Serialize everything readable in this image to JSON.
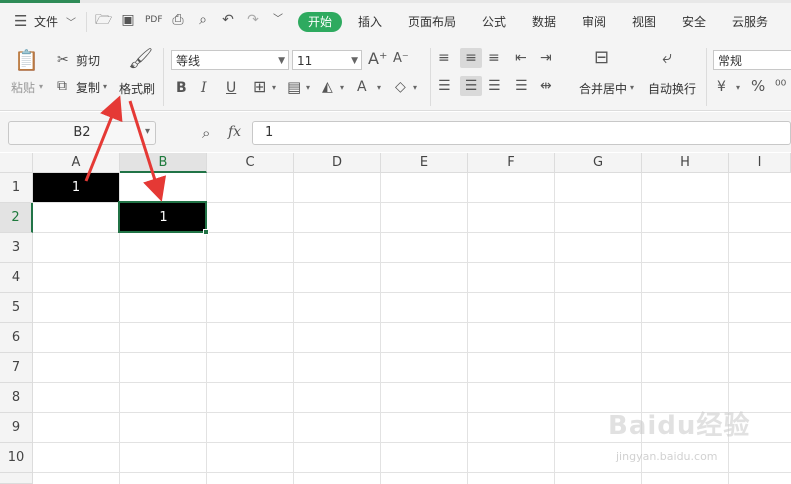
{
  "menubar": {
    "file_label": "文件",
    "tabs": [
      "开始",
      "插入",
      "页面布局",
      "公式",
      "数据",
      "审阅",
      "视图",
      "安全",
      "云服务"
    ],
    "active_tab": "开始"
  },
  "ribbon": {
    "paste_label": "粘贴",
    "cut_label": "剪切",
    "copy_label": "复制",
    "format_painter_label": "格式刷",
    "font_name": "等线",
    "font_size": "11",
    "merge_center_label": "合并居中",
    "wrap_text_label": "自动换行",
    "number_format": "常规",
    "percent_symbol": "%"
  },
  "formula_bar": {
    "name_box": "B2",
    "fx_label": "fx",
    "value": "1"
  },
  "sheet": {
    "columns": [
      "A",
      "B",
      "C",
      "D",
      "E",
      "F",
      "G",
      "H",
      "I"
    ],
    "rows": [
      "1",
      "2",
      "3",
      "4",
      "5",
      "6",
      "7",
      "8",
      "9",
      "10"
    ],
    "cells": {
      "A1": "1",
      "B2": "1"
    },
    "selected_cell": "B2"
  },
  "annotation": {
    "arrow_color": "#e53935"
  },
  "watermark": {
    "brand": "Baidu经验",
    "url": "jingyan.baidu.com"
  },
  "colors": {
    "accent_green": "#2eaa5f",
    "selection_green": "#217346",
    "cell_fill": "#000000",
    "cell_text": "#ffffff"
  }
}
